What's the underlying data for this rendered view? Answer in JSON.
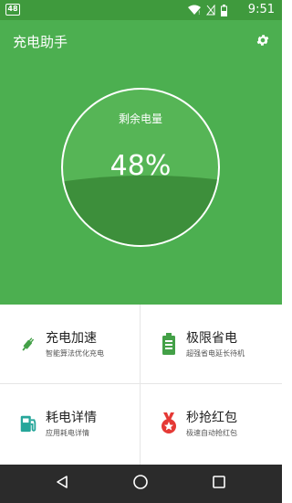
{
  "status_bar": {
    "badge": "48",
    "time": "9:51"
  },
  "app_bar": {
    "title": "充电助手",
    "settings_icon": "gear-icon"
  },
  "battery": {
    "label": "剩余电量",
    "percent_text": "48%",
    "level": 0.48
  },
  "features": [
    {
      "title": "充电加速",
      "subtitle": "智能算法优化充电",
      "icon": "plug-icon",
      "color": "#43a047"
    },
    {
      "title": "极限省电",
      "subtitle": "超强省电延长待机",
      "icon": "battery-icon",
      "color": "#43a047"
    },
    {
      "title": "耗电详情",
      "subtitle": "应用耗电详情",
      "icon": "fuel-pump-icon",
      "color": "#26a69a"
    },
    {
      "title": "秒抢红包",
      "subtitle": "极速自动抢红包",
      "icon": "medal-icon",
      "color": "#e53935"
    }
  ],
  "nav": {
    "back_icon": "back-triangle-icon",
    "home_icon": "home-circle-icon",
    "recent_icon": "recent-square-icon"
  },
  "colors": {
    "primary": "#4caf50",
    "status_bar": "#3f9a3d",
    "gauge_fill": "#3d8f3b",
    "nav_bar": "#2b2b2b"
  }
}
